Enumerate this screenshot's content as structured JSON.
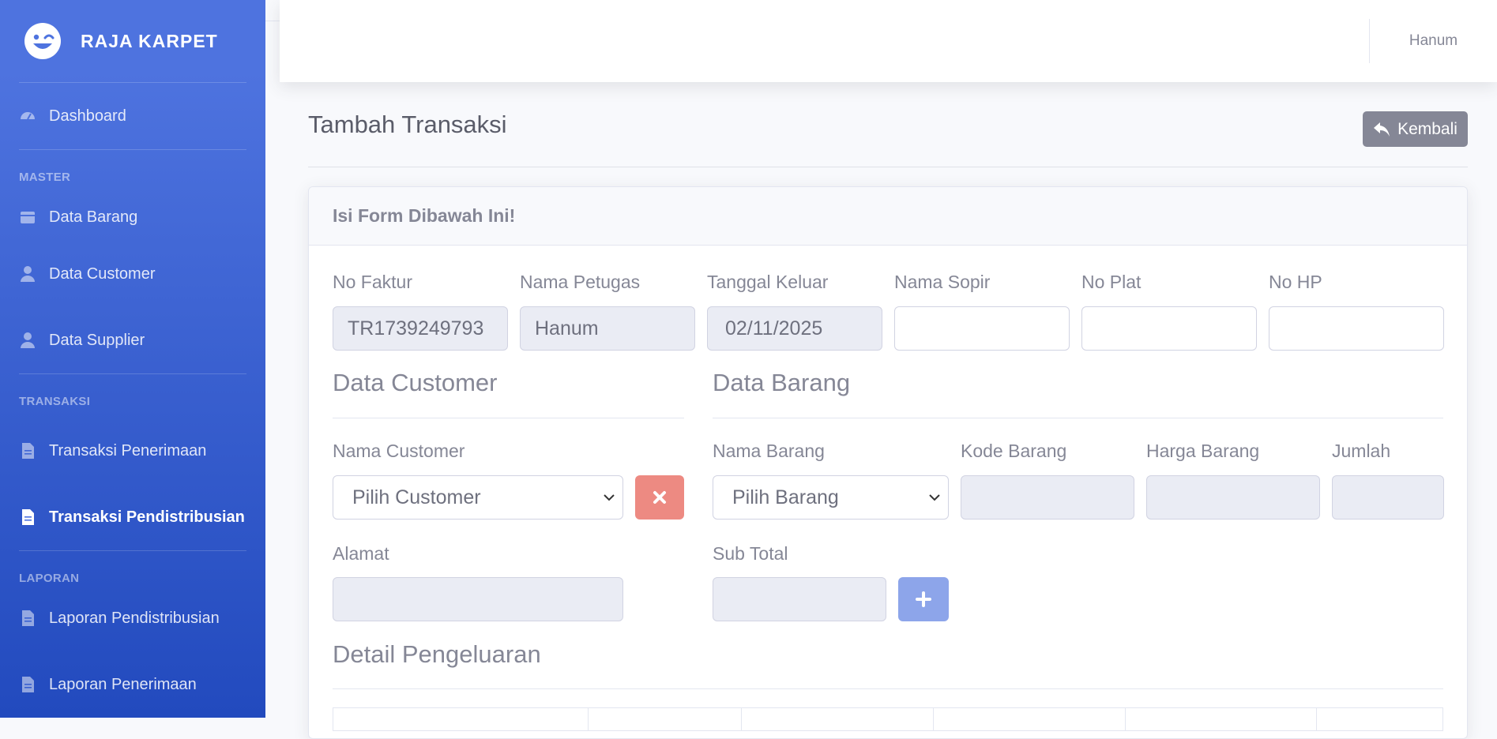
{
  "brand": {
    "name": "RAJA KARPET",
    "logo_icon": "laugh-wink-icon"
  },
  "sidebar": {
    "dashboard": "Dashboard",
    "heading_master": "MASTER",
    "data_barang": "Data Barang",
    "data_customer": "Data Customer",
    "data_supplier": "Data Supplier",
    "heading_transaksi": "TRANSAKSI",
    "transaksi_penerimaan": "Transaksi Penerimaan",
    "transaksi_pendistribusian": "Transaksi Pendistribusian",
    "heading_laporan": "LAPORAN",
    "laporan_pendistribusian": "Laporan Pendistribusian",
    "laporan_penerimaan": "Laporan Penerimaan"
  },
  "topbar": {
    "user_name": "Hanum"
  },
  "page": {
    "title": "Tambah Transaksi",
    "back_label": "Kembali"
  },
  "card": {
    "header": "Isi Form Dibawah Ini!"
  },
  "form": {
    "no_faktur": {
      "label": "No Faktur",
      "value": "TR1739249793"
    },
    "nama_petugas": {
      "label": "Nama Petugas",
      "value": "Hanum"
    },
    "tanggal_keluar": {
      "label": "Tanggal Keluar",
      "value": "02/11/2025"
    },
    "nama_sopir": {
      "label": "Nama Sopir",
      "value": ""
    },
    "no_plat": {
      "label": "No Plat",
      "value": ""
    },
    "no_hp": {
      "label": "No HP",
      "value": ""
    }
  },
  "customer": {
    "section_title": "Data Customer",
    "nama_label": "Nama Customer",
    "nama_selected": "Pilih Customer",
    "alamat_label": "Alamat",
    "alamat_value": ""
  },
  "barang": {
    "section_title": "Data Barang",
    "nama_label": "Nama Barang",
    "nama_selected": "Pilih Barang",
    "kode_label": "Kode Barang",
    "harga_label": "Harga Barang",
    "jumlah_label": "Jumlah",
    "subtotal_label": "Sub Total"
  },
  "detail": {
    "section_title": "Detail Pengeluaran"
  },
  "colors": {
    "sidebar_top": "#4e73df",
    "sidebar_bottom": "#224abe",
    "danger_button": "#ed8a82",
    "primary_button": "#8da5ea",
    "secondary_button": "#858796"
  }
}
